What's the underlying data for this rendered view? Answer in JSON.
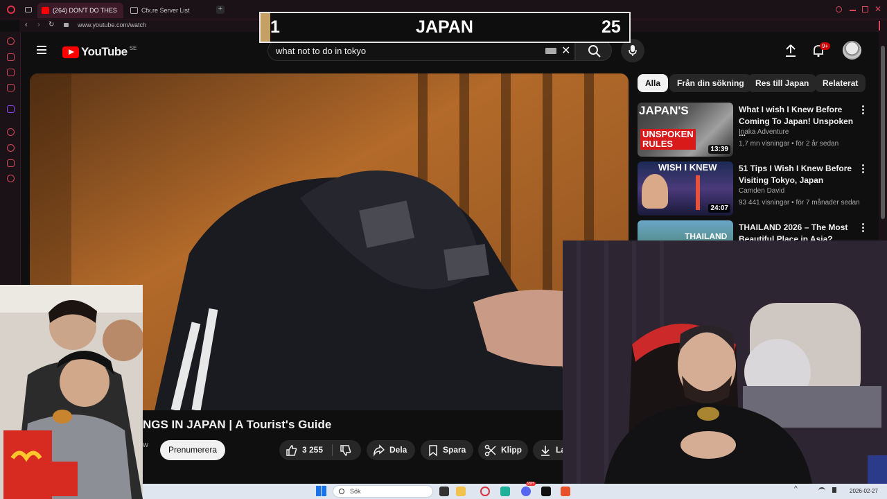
{
  "browser": {
    "tabs": [
      {
        "label": "(264) DON'T DO THES"
      },
      {
        "label": "Cfx.re Server List"
      }
    ],
    "url": "www.youtube.com/watch"
  },
  "youtube": {
    "logo_text": "YouTube",
    "region": "SE",
    "search_value": "what not to do in tokyo",
    "notification_badge": "9+",
    "chips": [
      "Alla",
      "Från din sökning",
      "Res till Japan",
      "Relaterat"
    ],
    "recommendations": [
      {
        "title": "What I wish I Knew Before Coming To Japan! Unspoken ...",
        "channel": "Inaka Adventure",
        "meta": "1,7 mn visningar • för 2 år sedan",
        "duration": "13:39",
        "thumb_text_top": "JAPAN'S",
        "thumb_text_bottom": "UNSPOKEN RULES"
      },
      {
        "title": "51 Tips I Wish I Knew Before Visiting Tokyo, Japan",
        "channel": "Camden David",
        "meta": "93 441 visningar • för 7 månader sedan",
        "duration": "24:07",
        "thumb_text_top": "WISH I KNEW"
      },
      {
        "title": "THAILAND 2026 – The Most Beautiful Place in Asia?",
        "thumb_text_top": "THAILAND"
      }
    ],
    "video": {
      "title": "NGS IN JAPAN | A Tourist's Guide",
      "subscribe_label": "Prenumerera",
      "likes": "3 255",
      "share_label": "Dela",
      "save_label": "Spara",
      "clip_label": "Klipp",
      "download_label": "La",
      "channel_fragment": "w"
    }
  },
  "overlay": {
    "left_number": "1",
    "center_label": "JAPAN",
    "right_number": "25"
  },
  "taskbar": {
    "search_placeholder": "Sök",
    "date": "2026-02-27",
    "badge": "99+"
  },
  "colors": {
    "yt_red": "#ff0000",
    "browser_accent": "#d9485a",
    "overlay_gold": "#c4a064"
  }
}
